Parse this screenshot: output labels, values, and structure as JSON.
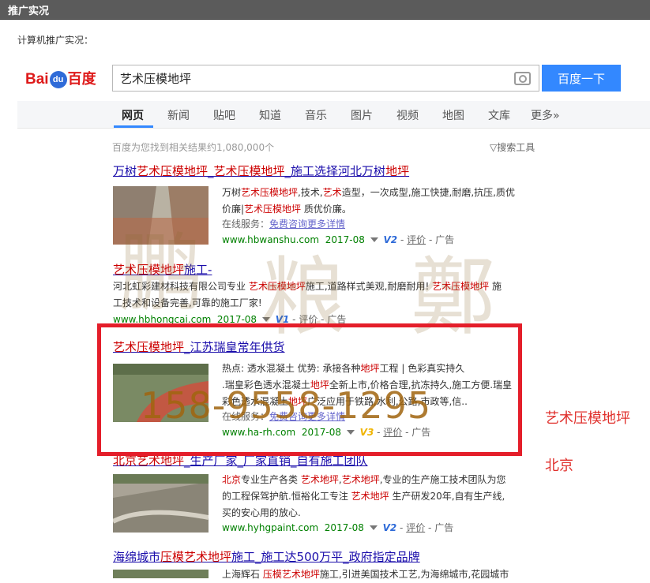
{
  "window": {
    "title": "推广实况"
  },
  "section_label": "计算机推广实况：",
  "baidu": {
    "logo": {
      "bai": "Bai",
      "du": "du",
      "cn": "百度"
    },
    "query": "艺术压模地坪",
    "button": "百度一下",
    "camera_icon": "camera-icon",
    "tabs": [
      "网页",
      "新闻",
      "贴吧",
      "知道",
      "音乐",
      "图片",
      "视频",
      "地图",
      "文库",
      "更多»"
    ],
    "active_tab": "网页",
    "result_count": "百度为您找到相关结果约1,080,000个",
    "search_tools": "搜索工具"
  },
  "results": [
    {
      "title": {
        "a": "万树",
        "b": "艺术压模地坪",
        "c": "_",
        "d": "艺术压模地坪",
        "e": "_施工选择河北万树",
        "f": "地坪"
      },
      "desc1": {
        "a": "万树",
        "b": "艺术压模地坪",
        "c": ",技术,",
        "d": "艺术",
        "e": "造型，一次成型,施工快捷,耐磨,抗压,质优"
      },
      "desc2": {
        "a": "价廉|",
        "b": "艺术压模地坪",
        "c": " 质优价廉。"
      },
      "service": {
        "label": "在线服务：",
        "link": "免费咨询更多详情"
      },
      "url": "www.hbwanshu.com",
      "date": "2017-08",
      "v": "V2",
      "review": "评价",
      "ad": "广告"
    },
    {
      "title": {
        "a": "艺术压模地坪",
        "b": "施工-"
      },
      "desc1": {
        "a": "河北虹彩建材科技有限公司专业 ",
        "b": "艺术压模地坪",
        "c": "施工,道路样式美观,耐磨耐用! ",
        "d": "艺术压模地坪",
        "e": " 施"
      },
      "desc2": "工技术和设备完善,可靠的施工厂家!",
      "url": "www.hbhongcai.com",
      "date": "2017-08",
      "v": "V1",
      "review": "评价",
      "ad": "广告"
    },
    {
      "title": {
        "a": "艺术压模地坪",
        "b": "_江苏瑞皇常年供货"
      },
      "desc1": {
        "a": "热点: 透水混凝土    优势: 承接各种",
        "b": "地坪",
        "c": "工程 | 色彩真实持久"
      },
      "desc2": {
        "a": ".瑞皇彩色透水混凝土",
        "b": "地坪",
        "c": "全新上市,价格合理,抗冻持久,施工方便.瑞皇"
      },
      "desc3": {
        "a": "彩色透水混凝土",
        "b": "地坪",
        "c": "广泛应用于铁路,水利,公路,市政等,信.."
      },
      "service": {
        "label": "在线服务：",
        "link": "免费咨询更多详情"
      },
      "url": "www.ha-rh.com",
      "date": "2017-08",
      "v": "V3",
      "review": "评价",
      "ad": "广告"
    },
    {
      "title": {
        "a": "北京",
        "b": "艺术地坪",
        "c": "_生产厂家_厂家直销_自有施工团队"
      },
      "desc1": {
        "a": "北京",
        "b": "专业生产各类 ",
        "c": "艺术地坪",
        "d": ",",
        "e": "艺术地坪",
        "f": ",专业的生产施工技术团队为您"
      },
      "desc2": {
        "a": "的工程保驾护航.恒裕化工专注 ",
        "b": "艺术地坪",
        "c": " 生产研发20年,自有生产线,"
      },
      "desc3": "买的安心用的放心.",
      "url": "www.hyhgpaint.com",
      "date": "2017-08",
      "v": "V2",
      "review": "评价",
      "ad": "广告"
    },
    {
      "title": {
        "a": "海绵城市",
        "b": "压模艺术地坪",
        "c": "施工_施工达500万平_政府指定品牌"
      },
      "desc1": {
        "a": "上海辉石 ",
        "b": "压模艺术地坪",
        "c": "施工,引进美国技术工艺,为海绵城市,花园城市"
      }
    }
  ],
  "overlay": {
    "phone": "158-9558-1295",
    "side_label_1": "艺术压模地坪",
    "side_label_2": "北京",
    "watermark": [
      "鹏",
      "粮",
      "鄭"
    ],
    "highlight_color": "#e41e2a"
  }
}
